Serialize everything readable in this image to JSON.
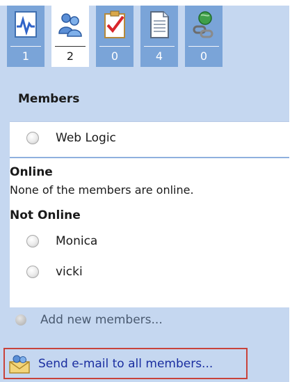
{
  "tabs": [
    {
      "icon": "activity-icon",
      "count": "1",
      "active": false
    },
    {
      "icon": "members-icon",
      "count": "2",
      "active": true
    },
    {
      "icon": "tasks-icon",
      "count": "0",
      "active": false
    },
    {
      "icon": "documents-icon",
      "count": "4",
      "active": false
    },
    {
      "icon": "links-icon",
      "count": "0",
      "active": false
    }
  ],
  "panel": {
    "title": "Members",
    "group_member": "Web Logic",
    "online_heading": "Online",
    "online_text": "None of the members are online.",
    "offline_heading": "Not Online",
    "offline_members": [
      "Monica",
      "vicki"
    ],
    "add_label": "Add new members...",
    "email_label": "Send e-mail to all members..."
  },
  "colors": {
    "panel_bg": "#c5d7f0",
    "tab_bg": "#7aa4d8",
    "highlight_border": "#c8423a",
    "link": "#1a2ea0"
  }
}
